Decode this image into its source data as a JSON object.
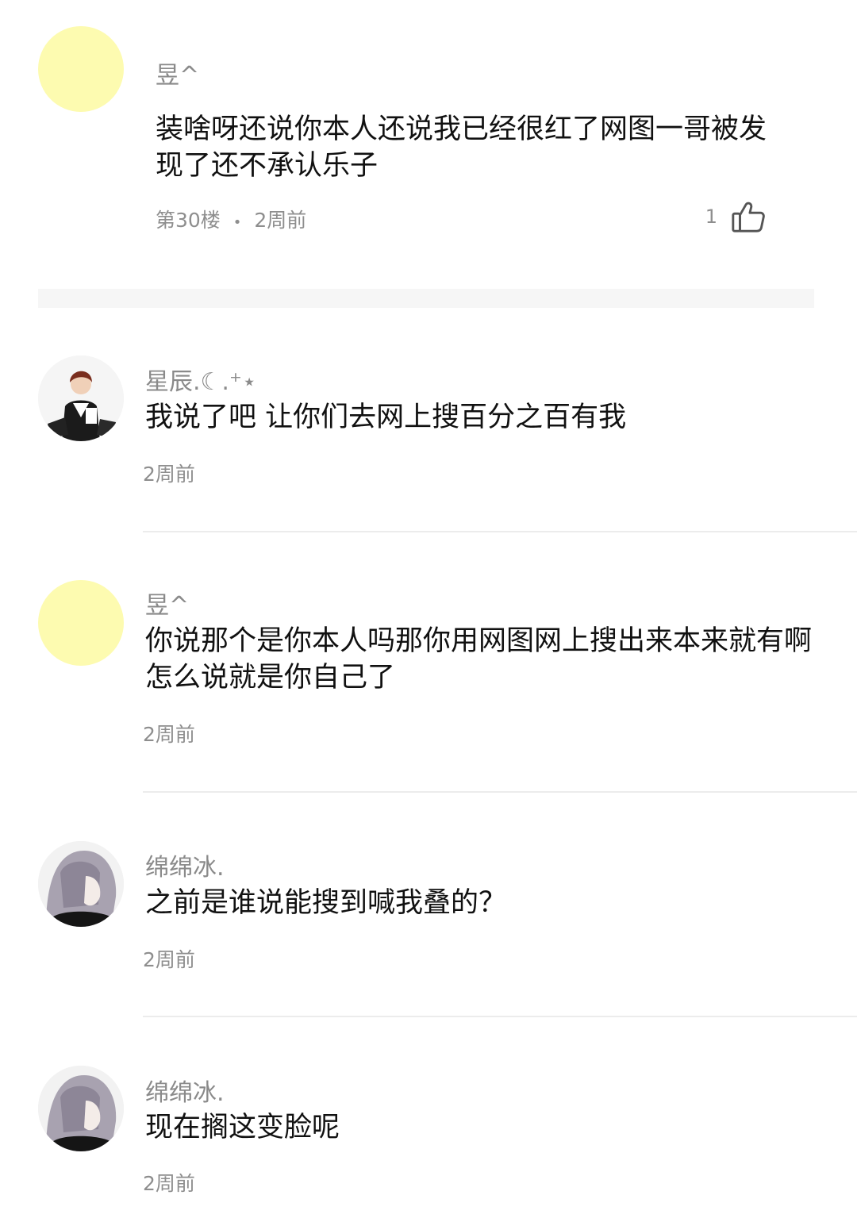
{
  "main_comment": {
    "username": "昱^",
    "content": "装啥呀还说你本人还说我已经很红了网图一哥被发现了还不承认乐子",
    "floor": "第30楼",
    "separator": "•",
    "time": "2周前",
    "like_count": "1",
    "avatar_color": "#fdfbb0"
  },
  "replies": [
    {
      "username": "星辰.☾.⁺⋆",
      "content": "我说了吧 让你们去网上搜百分之百有我",
      "time": "2周前",
      "avatar": "anime-boy-avatar"
    },
    {
      "username": "昱^",
      "content": "你说那个是你本人吗那你用网图网上搜出来本来就有啊怎么说就是你自己了",
      "time": "2周前",
      "avatar": "yellow-circle-avatar"
    },
    {
      "username": "绵绵冰.",
      "content": "之前是谁说能搜到喊我叠的？",
      "time": "2周前",
      "avatar": "grey-hair-anime-avatar"
    },
    {
      "username": "绵绵冰.",
      "content": "现在搁这变脸呢",
      "time": "2周前",
      "avatar": "grey-hair-anime-avatar"
    }
  ]
}
